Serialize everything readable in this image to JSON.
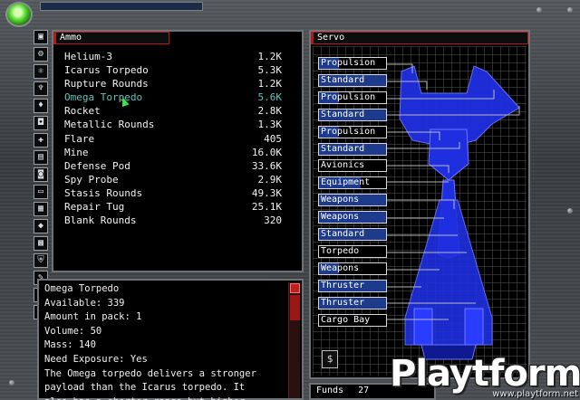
{
  "ammo": {
    "title": "Ammo",
    "items": [
      {
        "name": "Helium-3",
        "qty": "1.2K"
      },
      {
        "name": "Icarus Torpedo",
        "qty": "5.3K"
      },
      {
        "name": "Rupture Rounds",
        "qty": "1.2K"
      },
      {
        "name": "Omega Torpedo",
        "qty": "5.6K"
      },
      {
        "name": "Rocket",
        "qty": "2.8K"
      },
      {
        "name": "Metallic Rounds",
        "qty": "1.3K"
      },
      {
        "name": "Flare",
        "qty": "405"
      },
      {
        "name": "Mine",
        "qty": "16.0K"
      },
      {
        "name": "Defense Pod",
        "qty": "33.6K"
      },
      {
        "name": "Spy Probe",
        "qty": "2.9K"
      },
      {
        "name": "Stasis Rounds",
        "qty": "49.3K"
      },
      {
        "name": "Repair Tug",
        "qty": "25.1K"
      },
      {
        "name": "Blank Rounds",
        "qty": "320"
      }
    ],
    "selected": "Omega Torpedo"
  },
  "description": {
    "lines": [
      "Omega Torpedo",
      "Available: 339",
      "Amount in pack: 1",
      "Volume: 50",
      "Mass: 140",
      "Need Exposure: Yes",
      "The Omega torpedo delivers a stronger",
      "payload than the Icarus torpedo. It",
      "also has a shorter range but higher"
    ]
  },
  "servo": {
    "title": "Servo",
    "slots": [
      {
        "label": "Propulsion",
        "state": "pale"
      },
      {
        "label": "Standard",
        "state": "fill"
      },
      {
        "label": "Propulsion",
        "state": "pale"
      },
      {
        "label": "Standard",
        "state": "fill"
      },
      {
        "label": "Propulsion",
        "state": "pale"
      },
      {
        "label": "Standard",
        "state": "fill"
      },
      {
        "label": "Avionics",
        "state": "empty"
      },
      {
        "label": "Equipment",
        "state": "half"
      },
      {
        "label": "Weapons",
        "state": "fill"
      },
      {
        "label": "Weapons",
        "state": "fill"
      },
      {
        "label": "Standard",
        "state": "fill"
      },
      {
        "label": "Torpedo",
        "state": "empty"
      },
      {
        "label": "Weapons",
        "state": "pale"
      },
      {
        "label": "Thruster",
        "state": "fill"
      },
      {
        "label": "Thruster",
        "state": "fill"
      },
      {
        "label": "Cargo Bay",
        "state": "empty"
      }
    ]
  },
  "funds": {
    "label": "Funds",
    "value": "27"
  },
  "logo": {
    "word": "Playtform",
    "url": "www.playtform.net"
  },
  "colors": {
    "accent_red": "#b21a1a",
    "ship_blue": "#1f2fe0",
    "slot_blue": "#1e3a8c",
    "selected_cyan": "#5cc6c0"
  },
  "icons": [
    "monitor-icon",
    "gear-icon",
    "atom-icon",
    "plug-icon",
    "microphone-icon",
    "boot-icon",
    "crosshair-icon",
    "scanner-icon",
    "plate-icon",
    "battery-icon",
    "calculator-icon",
    "cube-icon",
    "box-icon",
    "shield-icon",
    "wrench-icon",
    "pen-icon",
    "cycle-icon"
  ]
}
